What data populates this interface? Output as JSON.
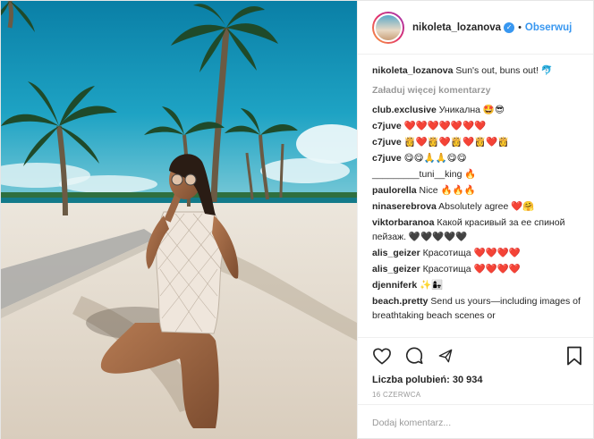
{
  "header": {
    "username": "nikoleta_lozanova",
    "follow_label": "Obserwuj",
    "separator": "•"
  },
  "caption": {
    "username": "nikoleta_lozanova",
    "text": "Sun's out, buns out! 🐬"
  },
  "load_more_label": "Załaduj więcej komentarzy",
  "comments": [
    {
      "user": "club.exclusive",
      "text": "Уникална 🤩😎"
    },
    {
      "user": "c7juve",
      "text": "❤️❤️❤️❤️❤️❤️❤️"
    },
    {
      "user": "c7juve",
      "text": "👸❤️👸❤️👸❤️👸❤️👸"
    },
    {
      "user": "c7juve",
      "text": "😋😋🙏🙏😋😋"
    },
    {
      "user": "",
      "text": "_________tuni__king 🔥"
    },
    {
      "user": "paulorella",
      "text": "Nice 🔥🔥🔥"
    },
    {
      "user": "ninaserebrova",
      "text": "Absolutely agree ❤️🤗"
    },
    {
      "user": "viktorbaranoa",
      "text": "Какой красивый за ее спиной пейзаж. 🖤🖤🖤🖤🖤"
    },
    {
      "user": "alis_geizer",
      "text": "Красотища ❤️❤️❤️❤️"
    },
    {
      "user": "alis_geizer",
      "text": "Красотища ❤️❤️❤️❤️"
    },
    {
      "user": "djenniferk",
      "text": "✨👩‍👧"
    },
    {
      "user": "beach.pretty",
      "text": "Send us yours—including images of breathtaking beach scenes or"
    }
  ],
  "likes_label": "Liczba polubień: 30 934",
  "date_label": "16 CZERWCA",
  "add_comment_placeholder": "Dodaj komentarz...",
  "icons": [
    "heart-icon",
    "comment-icon",
    "share-icon",
    "bookmark-icon",
    "verified-icon"
  ],
  "colors": {
    "accent": "#3897f0",
    "text": "#262626",
    "muted": "#999999"
  }
}
